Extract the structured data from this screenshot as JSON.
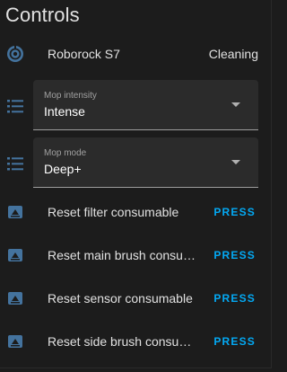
{
  "card": {
    "title": "Controls"
  },
  "vacuum": {
    "icon": "robot-vacuum-icon",
    "name": "Roborock S7",
    "state": "Cleaning"
  },
  "selects": [
    {
      "icon": "format-list-bulleted-icon",
      "label": "Mop intensity",
      "value": "Intense"
    },
    {
      "icon": "format-list-bulleted-icon",
      "label": "Mop mode",
      "value": "Deep+"
    }
  ],
  "buttons": [
    {
      "icon": "gesture-tap-button-icon",
      "label": "Reset filter consumable",
      "action": "PRESS"
    },
    {
      "icon": "gesture-tap-button-icon",
      "label": "Reset main brush consumable",
      "action": "PRESS"
    },
    {
      "icon": "gesture-tap-button-icon",
      "label": "Reset sensor consumable",
      "action": "PRESS"
    },
    {
      "icon": "gesture-tap-button-icon",
      "label": "Reset side brush consumable",
      "action": "PRESS"
    }
  ],
  "colors": {
    "background": "#1c1c1c",
    "icon": "#44739e",
    "accent": "#03a9f4",
    "select_bg": "#2b2b2b"
  }
}
